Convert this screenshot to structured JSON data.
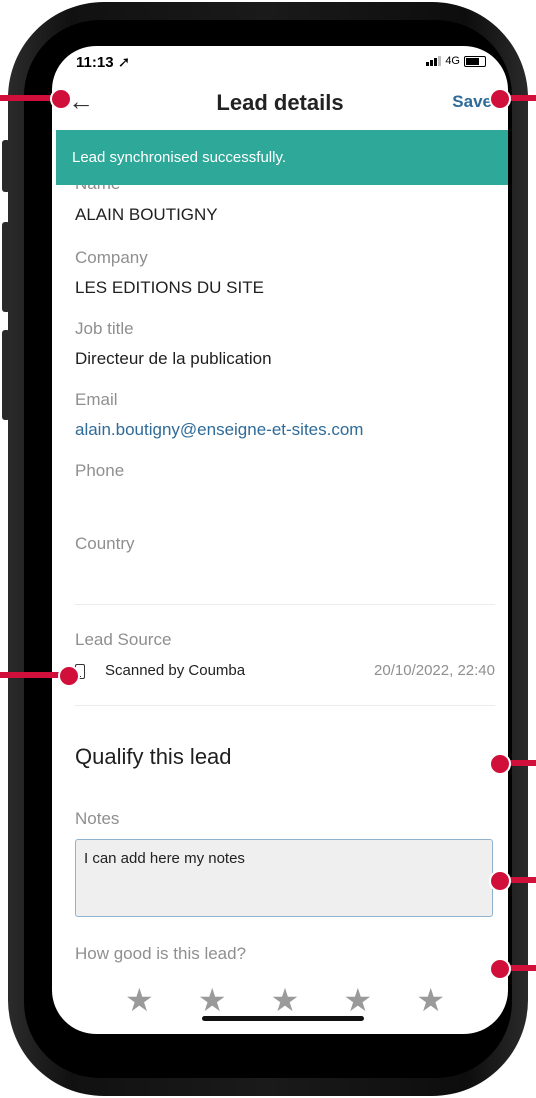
{
  "status_bar": {
    "time": "11:13",
    "network": "4G"
  },
  "header": {
    "title": "Lead details",
    "back_icon": "arrow-left-icon",
    "save_label": "Save"
  },
  "toast": {
    "message": "Lead synchronised successfully."
  },
  "fields": [
    {
      "label": "Name",
      "value": "ALAIN BOUTIGNY"
    },
    {
      "label": "Company",
      "value": "LES EDITIONS DU SITE"
    },
    {
      "label": "Job title",
      "value": "Directeur de la publication"
    },
    {
      "label": "Email",
      "value": "alain.boutigny@enseigne-et-sites.com"
    },
    {
      "label": "Phone",
      "value": ""
    },
    {
      "label": "Country",
      "value": ""
    }
  ],
  "lead_source": {
    "label": "Lead Source",
    "icon": "smartphone-icon",
    "text": "Scanned by Coumba",
    "date": "20/10/2022, 22:40"
  },
  "qualify": {
    "title": "Qualify this lead",
    "notes_label": "Notes",
    "notes_value": "I can add here my notes",
    "rating_label": "How good is this lead?",
    "rating": 0,
    "max_rating": 5
  },
  "colors": {
    "accent": "#2f6b99",
    "toast_bg": "#2ea899",
    "callout": "#d0103a",
    "star_empty": "#9a9a9a"
  }
}
